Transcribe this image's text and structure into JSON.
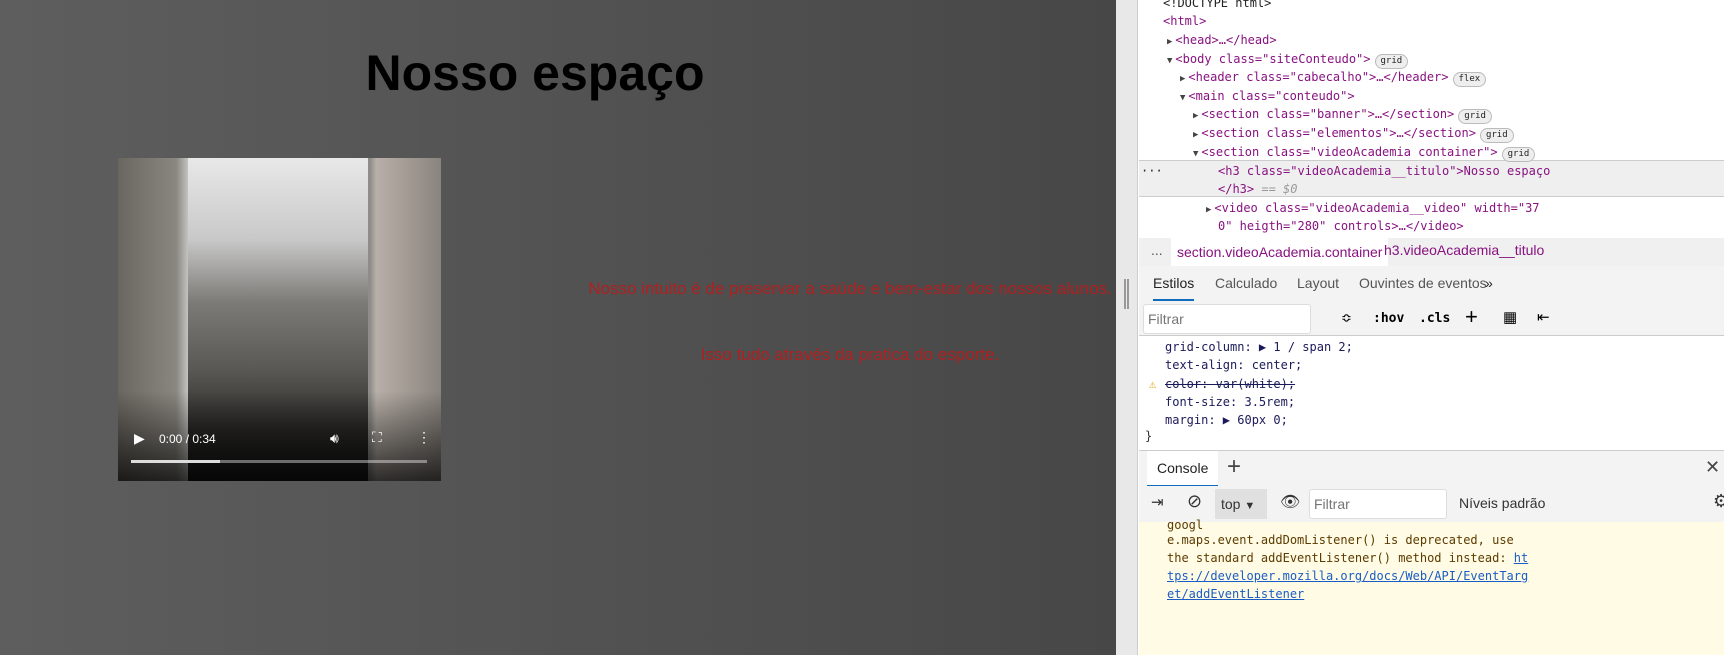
{
  "page": {
    "title": "Nosso espaço",
    "video": {
      "time": "0:00 / 0:34",
      "progress_buffered": 0.3
    },
    "paragraph1": "Nosso intuito é de preservar a saúde e bem-estar dos nossos alunos.",
    "paragraph2": "Isso tudo através da pratica do esporte.",
    "text_color": "#b02020"
  },
  "devtools": {
    "dom": [
      "<!DOCTYPE html>",
      "<html>",
      "<head>…</head>",
      "<body class=\"siteConteudo\">",
      "<header class=\"cabecalho\">…</header>",
      "<main class=\"conteudo\">",
      "<section class=\"banner\">…</section>",
      "<section class=\"elementos\">…</section>",
      "<section class=\"videoAcademia container\">",
      "<h3 class=\"videoAcademia__titulo\">Nosso espaço",
      "</h3>",
      "== $0",
      "<video class=\"videoAcademia__video\" width=\"37",
      "0\" heigth=\"280\" controls>…</video>"
    ],
    "badges": {
      "grid": "grid",
      "flex": "flex"
    },
    "breadcrumbs": [
      "...",
      "section.videoAcademia.container",
      "h3.videoAcademia__titulo"
    ],
    "tabs": [
      "Estilos",
      "Calculado",
      "Layout",
      "Ouvintes de eventos",
      "»"
    ],
    "filter_placeholder": "Filtrar",
    "tools": [
      ":hov",
      ".cls"
    ],
    "styles": [
      "grid-column: ▶ 1 / span 2;",
      "text-align: center;",
      "color: var(white);",
      "font-size: 3.5rem;",
      "margin: ▶ 60px 0;",
      "}"
    ],
    "console": {
      "tab": "Console",
      "context": "top",
      "filter_placeholder": "Filtrar",
      "levels": "Níveis padrão",
      "message": [
        "googl",
        "e.maps.event.addDomListener() is deprecated, use",
        "the standard addEventListener() method instead: "
      ],
      "link": [
        "ht",
        "tps://developer.mozilla.org/docs/Web/API/EventTarg",
        "et/addEventListener"
      ]
    },
    "accent": "#0f6cbd"
  }
}
